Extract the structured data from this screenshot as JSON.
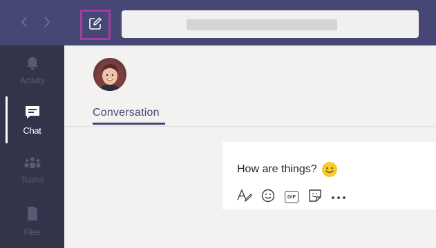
{
  "search": {
    "value": "",
    "placeholder": ""
  },
  "rail": {
    "items": [
      {
        "label": "Activity",
        "icon": "bell-icon"
      },
      {
        "label": "Chat",
        "icon": "chat-icon"
      },
      {
        "label": "Teams",
        "icon": "teams-icon"
      },
      {
        "label": "Files",
        "icon": "files-icon"
      }
    ],
    "active": "Chat"
  },
  "chat": {
    "tab_label": "Conversation",
    "message": "How are things?",
    "message_emoji": "smiley-emoji-icon"
  },
  "toolbar": {
    "icons": [
      "format-icon",
      "emoji-icon",
      "gif-icon",
      "sticker-icon",
      "more-icon"
    ],
    "gif_text": "GIF"
  },
  "colors": {
    "topbar": "#464775",
    "rail": "#33344a",
    "compose_highlight": "#a33ca3",
    "accent": "#464775",
    "emoji": "#f8c82d"
  }
}
